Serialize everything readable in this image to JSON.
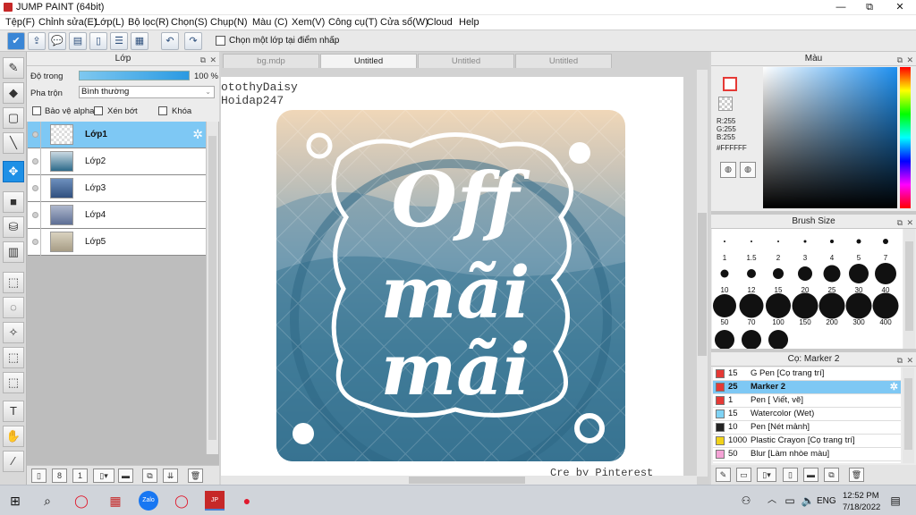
{
  "titlebar": {
    "title": "JUMP PAINT (64bit)",
    "minimize": "—",
    "restore": "⧉",
    "close": "✕"
  },
  "menu": [
    "Tệp(F)",
    "Chỉnh sửa(E)",
    "Lớp(L)",
    "Bộ lọc(R)",
    "Chọn(S)",
    "Chụp(N)",
    "Màu (C)",
    "Xem(V)",
    "Công cụ(T)",
    "Cửa sổ(W)",
    "Cloud",
    "Help"
  ],
  "toolbar": {
    "checkbox_label": "Chọn một lớp tại điểm nhấp"
  },
  "layer_panel": {
    "title": "Lớp",
    "opacity_label": "Độ trong",
    "opacity_value": "100 %",
    "blend_label": "Pha trộn",
    "blend_value": "Bình thường",
    "protect_alpha": "Bảo vệ alpha",
    "clip": "Xén bớt",
    "lock": "Khóa",
    "layers": [
      {
        "name": "Lớp1",
        "selected": true
      },
      {
        "name": "Lớp2",
        "selected": false
      },
      {
        "name": "Lớp3",
        "selected": false
      },
      {
        "name": "Lớp4",
        "selected": false
      },
      {
        "name": "Lớp5",
        "selected": false
      }
    ]
  },
  "canvas": {
    "tabs": [
      "bg.mdp",
      "Untitled",
      "Untitled",
      "Untitled"
    ],
    "active_tab": 1,
    "watermark_line1": "otothyDaisy",
    "watermark_line2": "Hoidap247",
    "watermark_bottom": "Cre by Pinterest",
    "artwork_text": [
      "Off",
      "mãi",
      "mãi"
    ]
  },
  "color_panel": {
    "title": "Màu",
    "r": "R:255",
    "g": "G:255",
    "b": "B:255",
    "hex": "#FFFFFF"
  },
  "brush_panel": {
    "title": "Brush Size",
    "sizes": [
      "1",
      "1.5",
      "2",
      "3",
      "4",
      "5",
      "7",
      "10",
      "12",
      "15",
      "20",
      "25",
      "30",
      "40",
      "50",
      "70",
      "100",
      "150",
      "200",
      "300",
      "400"
    ]
  },
  "pen_panel": {
    "title": "Cọ: Marker 2",
    "pens": [
      {
        "size": "15",
        "name": "G Pen [Cọ trang trí]",
        "color": "#e53935",
        "selected": false
      },
      {
        "size": "25",
        "name": "Marker 2",
        "color": "#e53935",
        "selected": true
      },
      {
        "size": "1",
        "name": "Pen [ Viết, vẽ]",
        "color": "#e53935",
        "selected": false
      },
      {
        "size": "15",
        "name": "Watercolor (Wet)",
        "color": "#7fd3f5",
        "selected": false
      },
      {
        "size": "10",
        "name": "Pen [Nét mảnh]",
        "color": "#222222",
        "selected": false
      },
      {
        "size": "1000",
        "name": "Plastic Crayon [Cọ trang trí]",
        "color": "#f1d21a",
        "selected": false
      },
      {
        "size": "50",
        "name": "Blur [Làm nhòe màu]",
        "color": "#f5a3d6",
        "selected": false
      }
    ]
  },
  "taskbar": {
    "lang": "ENG",
    "time": "12:52 PM",
    "date": "7/18/2022"
  }
}
